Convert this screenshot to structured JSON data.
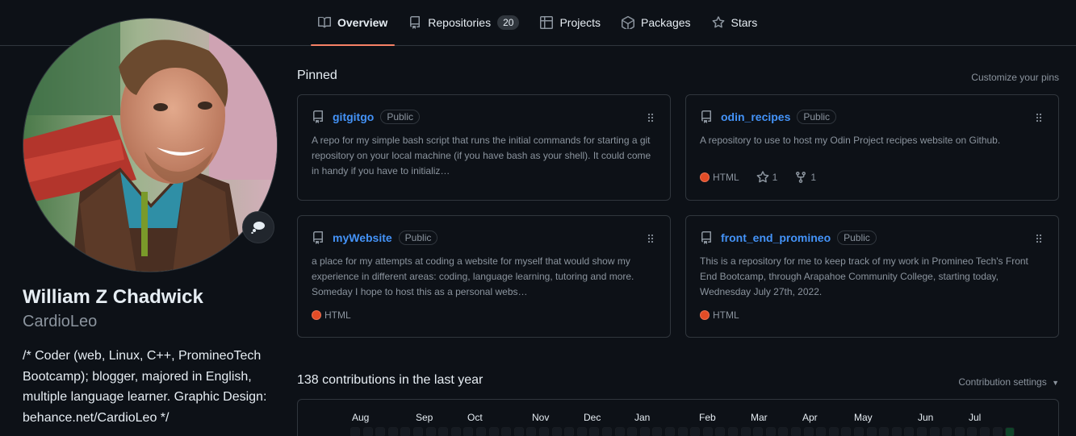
{
  "tabs": [
    {
      "label": "Overview",
      "icon": "book-icon",
      "active": true
    },
    {
      "label": "Repositories",
      "icon": "repo-icon",
      "count": "20"
    },
    {
      "label": "Projects",
      "icon": "table-icon"
    },
    {
      "label": "Packages",
      "icon": "package-icon"
    },
    {
      "label": "Stars",
      "icon": "star-icon"
    }
  ],
  "profile": {
    "name": "William Z Chadwick",
    "username": "CardioLeo",
    "bio": "/* Coder (web, Linux, C++, PromineoTech Bootcamp); blogger, majored in English, multiple language learner. Graphic Design: behance.net/CardioLeo */"
  },
  "pinned": {
    "title": "Pinned",
    "customize": "Customize your pins",
    "repos": [
      {
        "name": "gitgitgo",
        "visibility": "Public",
        "description": "A repo for my simple bash script that runs the initial commands for starting a git repository on your local machine (if you have bash as your shell). It could come in handy if you have to initializ…"
      },
      {
        "name": "odin_recipes",
        "visibility": "Public",
        "description": "A repository to use to host my Odin Project recipes website on Github.",
        "language": "HTML",
        "stars": "1",
        "forks": "1"
      },
      {
        "name": "myWebsite",
        "visibility": "Public",
        "description": "a place for my attempts at coding a website for myself that would show my experience in different areas: coding, language learning, tutoring and more. Someday I hope to host this as a personal webs…",
        "language": "HTML"
      },
      {
        "name": "front_end_promineo",
        "visibility": "Public",
        "description": "This is a repository for me to keep track of my work in Promineo Tech's Front End Bootcamp, through Arapahoe Community College, starting today, Wednesday July 27th, 2022.",
        "language": "HTML"
      }
    ]
  },
  "contributions": {
    "title": "138 contributions in the last year",
    "settings": "Contribution settings",
    "months": [
      "Aug",
      "Sep",
      "Oct",
      "Nov",
      "Dec",
      "Jan",
      "Feb",
      "Mar",
      "Apr",
      "May",
      "Jun",
      "Jul"
    ]
  },
  "colors": {
    "accent": "#f78166",
    "link": "#4493f8",
    "html_language": "#e34c26"
  }
}
